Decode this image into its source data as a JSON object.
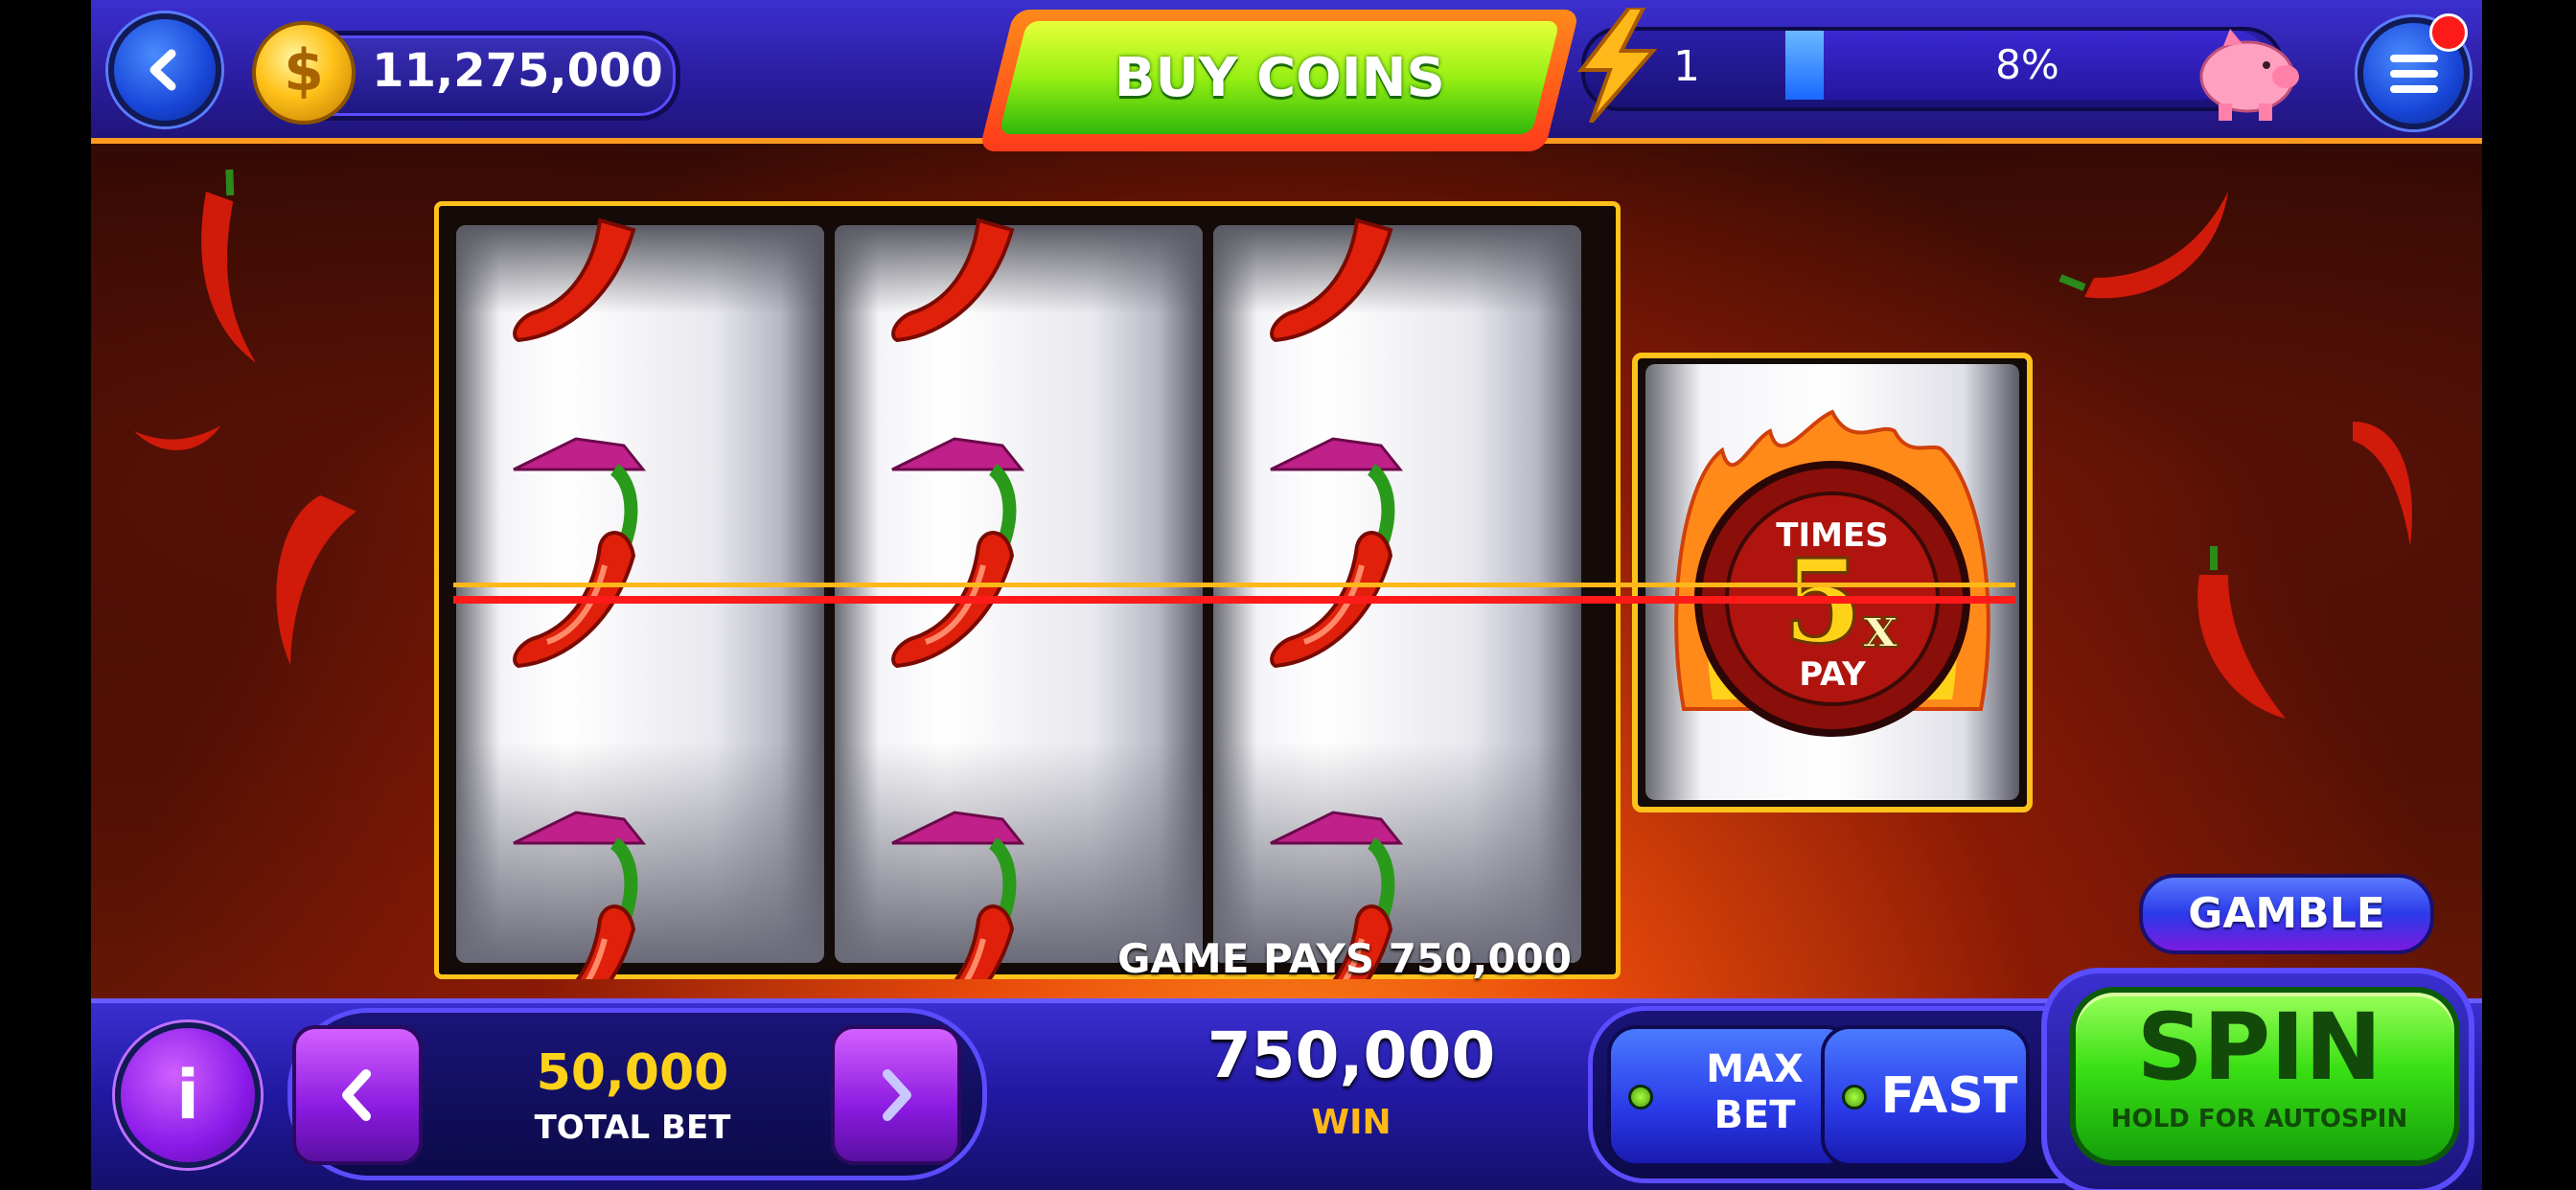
{
  "header": {
    "coins": "11,275,000",
    "buy_label": "BUY COINS",
    "level": "1",
    "xp_percent_text": "8%",
    "xp_progress": 0.08
  },
  "reels": {
    "reel_symbols": [
      "chili-pepper",
      "chili-pepper",
      "chili-pepper"
    ],
    "bonus_symbol": {
      "top": "TIMES",
      "multiplier": "5",
      "x": "x",
      "bottom": "PAY"
    }
  },
  "game_pays": "GAME PAYS 750,000",
  "gamble_label": "GAMBLE",
  "bottom": {
    "bet_value": "50,000",
    "bet_label": "TOTAL BET",
    "win_value": "750,000",
    "win_label": "WIN",
    "max_bet_line1": "MAX",
    "max_bet_line2": "BET",
    "fast_label": "FAST",
    "spin_label": "SPIN",
    "spin_sub": "HOLD FOR AUTOSPIN",
    "info_label": "i"
  },
  "icons": [
    "back-icon",
    "coin-icon",
    "lightning-icon",
    "piggy-bank-icon",
    "menu-icon",
    "info-icon",
    "chevron-left-icon",
    "chevron-right-icon"
  ],
  "colors": {
    "accent": "#ffc21a",
    "spin_green": "#3ae014",
    "payline": "#ff1a1a"
  }
}
